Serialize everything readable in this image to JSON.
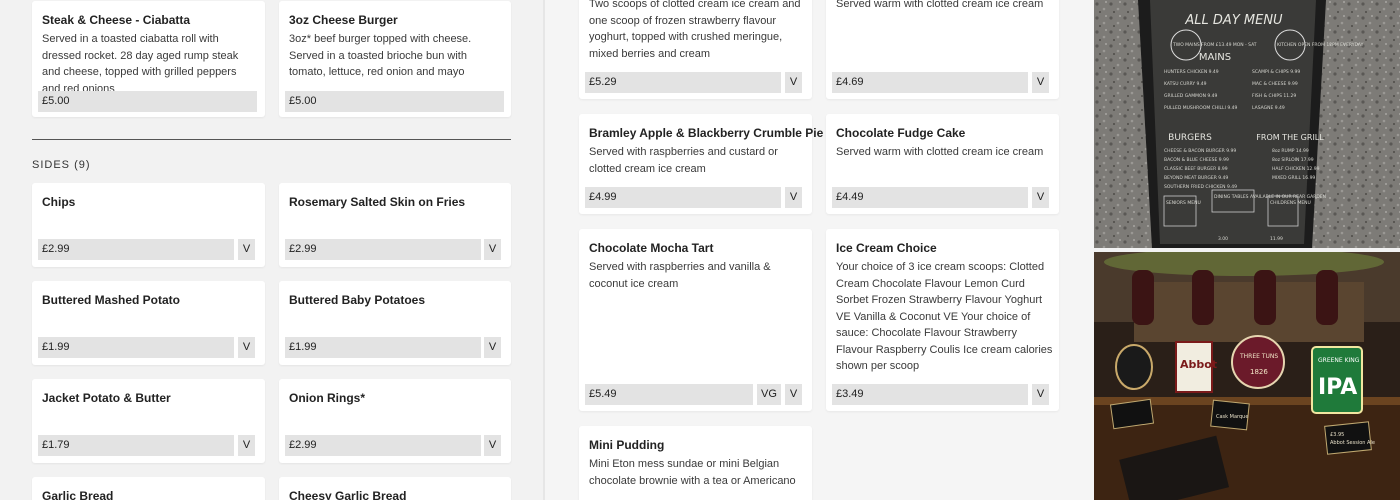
{
  "left_top_cards": [
    {
      "title": "Steak & Cheese - Ciabatta",
      "desc": "Served in a toasted ciabatta roll with dressed rocket. 28 day aged rump steak and cheese, topped with grilled peppers and red onions",
      "price": "£5.00"
    },
    {
      "title": "3oz Cheese Burger",
      "desc": "3oz* beef burger topped with cheese. Served in a toasted brioche bun with tomato, lettuce, red onion and mayo",
      "price": "£5.00"
    }
  ],
  "sides": {
    "heading": "SIDES (9)",
    "items": [
      {
        "title": "Chips",
        "price": "£2.99",
        "tag": "V"
      },
      {
        "title": "Rosemary Salted Skin on Fries",
        "price": "£2.99",
        "tag": "V"
      },
      {
        "title": "Buttered Mashed Potato",
        "price": "£1.99",
        "tag": "V"
      },
      {
        "title": "Buttered Baby Potatoes",
        "price": "£1.99",
        "tag": "V"
      },
      {
        "title": "Jacket Potato & Butter",
        "price": "£1.79",
        "tag": "V"
      },
      {
        "title": "Onion Rings*",
        "price": "£2.99",
        "tag": "V"
      },
      {
        "title": "Garlic Bread"
      },
      {
        "title": "Cheesy Garlic Bread"
      }
    ]
  },
  "desserts": [
    {
      "desc": "Two scoops of clotted cream ice cream and one scoop of frozen strawberry flavour yoghurt, topped with crushed meringue, mixed berries and cream",
      "price": "£5.29",
      "tag": "V"
    },
    {
      "desc": "Served warm with clotted cream ice cream",
      "price": "£4.69",
      "tag": "V"
    },
    {
      "title": "Bramley Apple & Blackberry Crumble Pie",
      "desc": "Served with raspberries and custard or clotted cream ice cream",
      "price": "£4.99",
      "tag": "V"
    },
    {
      "title": "Chocolate Fudge Cake",
      "desc": "Served warm with clotted cream ice cream",
      "price": "£4.49",
      "tag": "V"
    },
    {
      "title": "Chocolate Mocha Tart",
      "desc": "Served with raspberries and vanilla & coconut ice cream",
      "price": "£5.49",
      "tag": "V",
      "tag2": "VG"
    },
    {
      "title": "Ice Cream Choice",
      "desc": "Your choice of 3 ice cream scoops: Clotted Cream Chocolate Flavour Lemon Curd Sorbet Frozen Strawberry Flavour Yoghurt VE Vanilla & Coconut VE Your choice of sauce: Chocolate Flavour Strawberry Flavour Raspberry Coulis Ice cream calories shown per scoop",
      "price": "£3.49",
      "tag": "V"
    },
    {
      "title": "Mini Pudding",
      "desc": "Mini Eton mess sundae or mini Belgian chocolate brownie with a tea or Americano"
    }
  ],
  "chalkboard": {
    "title": "ALL DAY MENU",
    "badge_left": "TWO MAINS FROM £13.49 MON - SAT",
    "badge_right": "KITCHEN OPEN FROM 12PM EVERYDAY",
    "mains_heading": "MAINS",
    "mains_left": [
      "HUNTERS CHICKEN 9.49",
      "KATSU CURRY 9.49",
      "GRILLED GAMMON 9.49",
      "PULLED MUSHROOM CHILLI 9.49"
    ],
    "mains_right": [
      "SCAMPI & CHIPS 9.99",
      "MAC & CHEESE 9.99",
      "FISH & CHIPS 11.29",
      "LASAGNE 9.49"
    ],
    "burgers_heading": "BURGERS",
    "grill_heading": "FROM THE GRILL",
    "burgers": [
      "CHEESE & BACON BURGER 9.99",
      "BACON & BLUE CHEESE 9.99",
      "CLASSIC BEEF BURGER 8.99",
      "BEYOND MEAT BURGER 9.49",
      "SOUTHERN FRIED CHICKEN 9.49"
    ],
    "grill": [
      "8oz RUMP 14.99",
      "8oz SIRLOIN 17.99",
      "HALF CHICKEN 12.99",
      "MIXED GRILL 16.99"
    ],
    "footer_left": "SENIORS MENU",
    "footer_mid": "DINING TABLES AVAILABLE IN OUR REAR GARDEN",
    "footer_right": "CHILDRENS MENU",
    "bottom_prices": [
      "3.00",
      "11.99"
    ]
  },
  "bar_photo": {
    "pump_clip_ipa_brand": "GREENE KING",
    "pump_clip_ipa": "IPA",
    "pump_clip_mid": "THREE TUNS",
    "pump_clip_mid_year": "1826",
    "pump_clip_left": "Abbot",
    "price_tags": [
      "Cask Marque",
      "£3.95",
      "Abbot Session Ale"
    ]
  }
}
